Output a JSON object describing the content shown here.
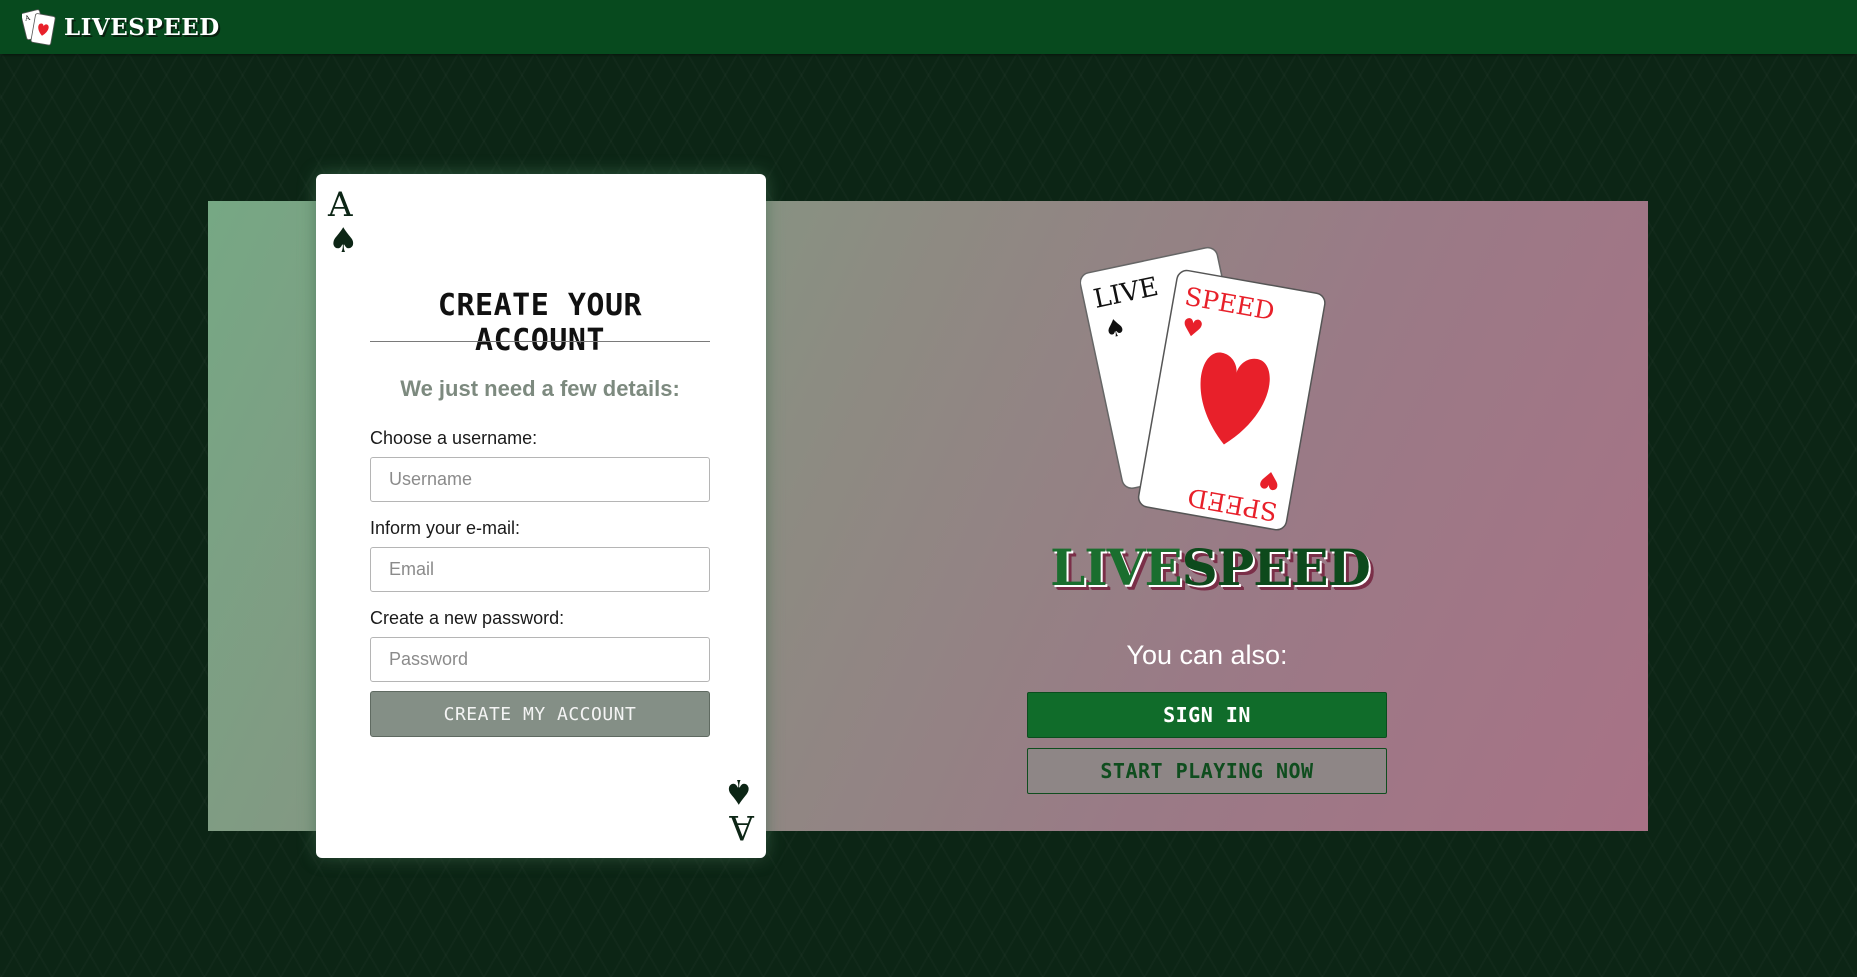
{
  "header": {
    "brand_name": "LIVESPEED",
    "brand_icon": "playing-cards-icon"
  },
  "signup_card": {
    "corner_rank": "A",
    "corner_suit": "♠",
    "title": "CREATE YOUR ACCOUNT",
    "subtitle": "We just need a few details:",
    "username": {
      "label": "Choose a username:",
      "placeholder": "Username",
      "value": ""
    },
    "email": {
      "label": "Inform your e-mail:",
      "placeholder": "Email",
      "value": ""
    },
    "password": {
      "label": "Create a new password:",
      "placeholder": "Password",
      "value": ""
    },
    "submit_label": "CREATE MY ACCOUNT"
  },
  "promo": {
    "logo_card_left": "LIVE",
    "logo_card_right": "SPEED",
    "logo_word_part1": "LIVE",
    "logo_word_part2": "SPEED",
    "also_text": "You can also:",
    "signin_label": "SIGN IN",
    "play_label": "START PLAYING NOW"
  },
  "colors": {
    "topbar": "#074a1e",
    "background": "#0c2515",
    "accent_green": "#106c2a",
    "heart_red": "#e8202a",
    "button_gray": "#848f86"
  }
}
